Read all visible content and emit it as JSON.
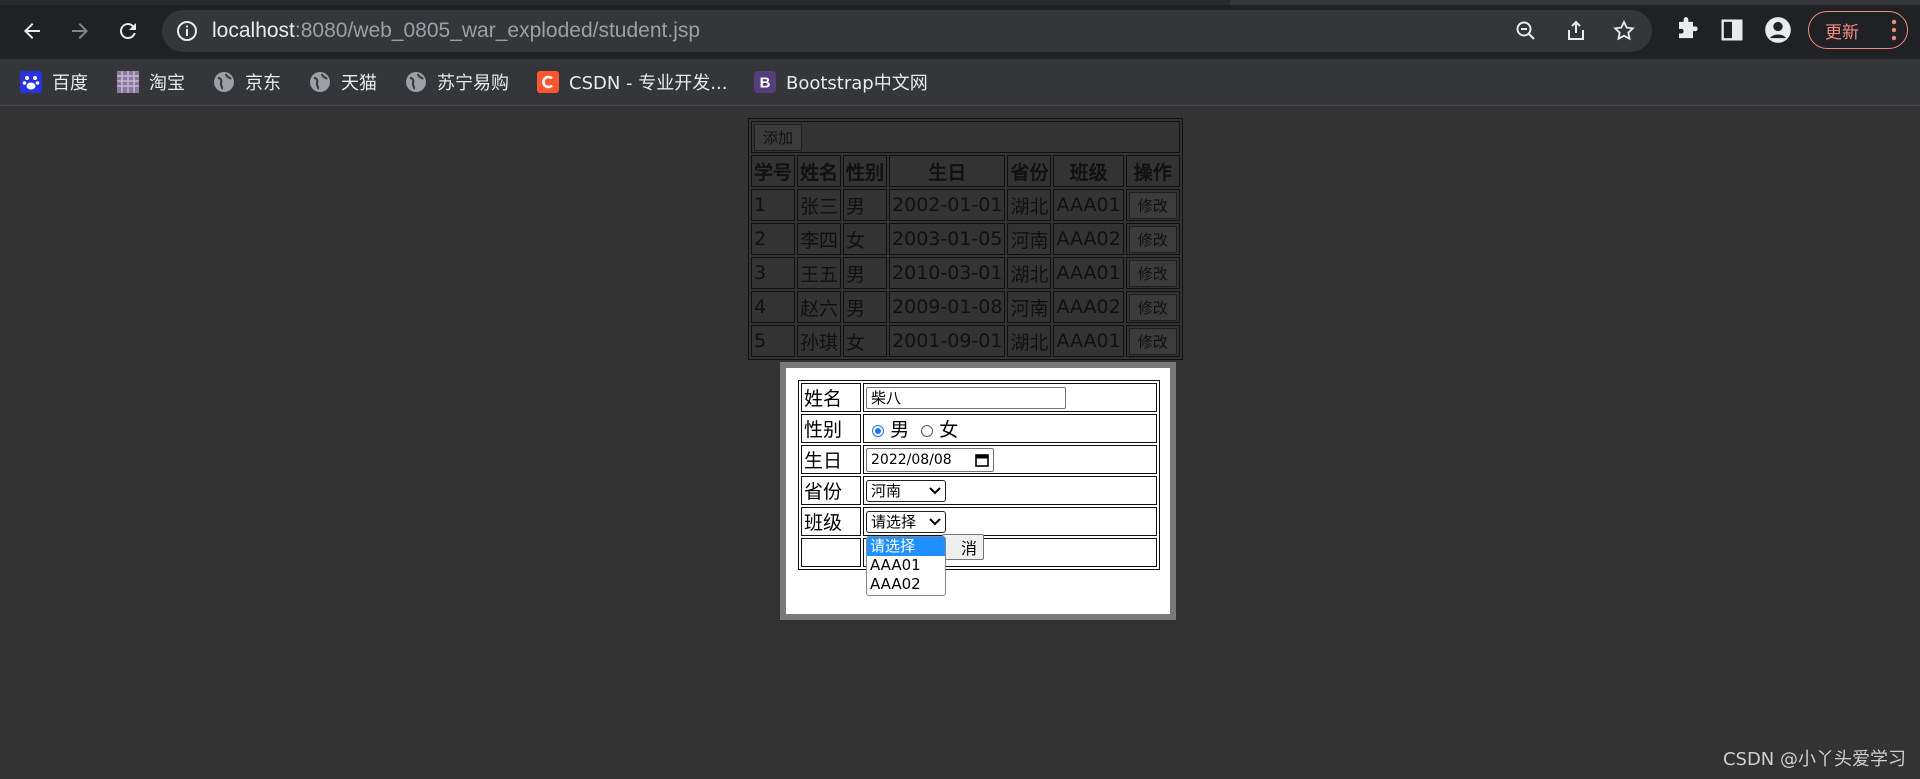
{
  "browser": {
    "url_host": "localhost",
    "url_rest": ":8080/web_0805_war_exploded/student.jsp",
    "update_label": "更新",
    "bookmarks": [
      {
        "label": "百度",
        "icon": "baidu-icon"
      },
      {
        "label": "淘宝",
        "icon": "taobao-icon"
      },
      {
        "label": "京东",
        "icon": "globe-icon"
      },
      {
        "label": "天猫",
        "icon": "globe-icon"
      },
      {
        "label": "苏宁易购",
        "icon": "globe-icon"
      },
      {
        "label": "CSDN - 专业开发...",
        "icon": "csdn-icon"
      },
      {
        "label": "Bootstrap中文网",
        "icon": "bootstrap-icon"
      }
    ]
  },
  "student_table": {
    "add_label": "添加",
    "headers": [
      "学号",
      "姓名",
      "性别",
      "生日",
      "省份",
      "班级",
      "操作"
    ],
    "edit_label": "修改",
    "rows": [
      {
        "id": "1",
        "name": "张三",
        "gender": "男",
        "birthday": "2002-01-01",
        "province": "湖北",
        "class": "AAA01"
      },
      {
        "id": "2",
        "name": "李四",
        "gender": "女",
        "birthday": "2003-01-05",
        "province": "河南",
        "class": "AAA02"
      },
      {
        "id": "3",
        "name": "王五",
        "gender": "男",
        "birthday": "2010-03-01",
        "province": "湖北",
        "class": "AAA01"
      },
      {
        "id": "4",
        "name": "赵六",
        "gender": "男",
        "birthday": "2009-01-08",
        "province": "河南",
        "class": "AAA02"
      },
      {
        "id": "5",
        "name": "孙琪",
        "gender": "女",
        "birthday": "2001-09-01",
        "province": "湖北",
        "class": "AAA01"
      }
    ]
  },
  "form": {
    "name_label": "姓名",
    "name_value": "柴八",
    "gender_label": "性别",
    "gender_male": "男",
    "gender_female": "女",
    "gender_selected": "男",
    "birthday_label": "生日",
    "birthday_value": "2022/08/08",
    "province_label": "省份",
    "province_value": "河南",
    "class_label": "班级",
    "class_value": "请选择",
    "class_options": [
      "请选择",
      "AAA01",
      "AAA02"
    ],
    "cancel_label_visible": "消"
  },
  "watermark": "CSDN @小丫头爱学习",
  "colors": {
    "page_bg": "#333333",
    "chrome_bg": "#202124",
    "update_accent": "#f28b82",
    "dropdown_highlight": "#1e90ff"
  }
}
